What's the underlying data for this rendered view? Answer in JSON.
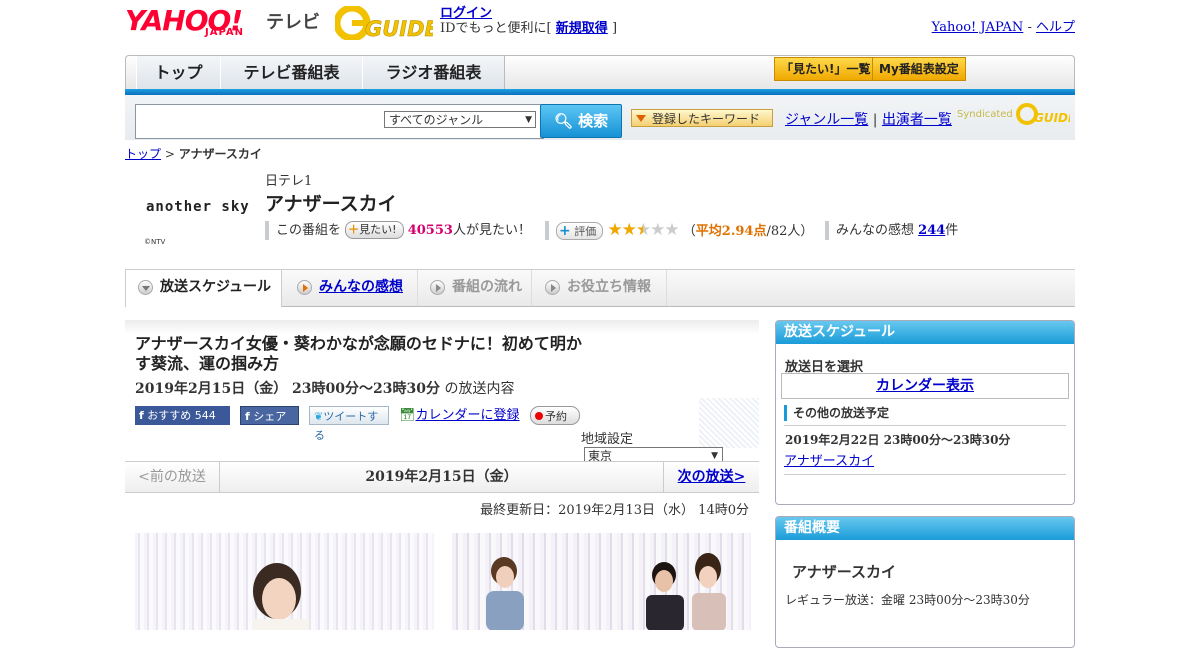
{
  "header": {
    "logo_yahoo": "YAHOO!",
    "logo_japan": "JAPAN",
    "logo_tv": "テレビ",
    "logo_guide": "GUIDE",
    "login_label": "ログイン",
    "id_text": "IDでもっと便利に[",
    "signup_label": "新規取得",
    "id_text_end": "]",
    "yahoo_japan_link": "Yahoo! JAPAN",
    "dash": "-",
    "help_link": "ヘルプ"
  },
  "gnav": {
    "tabs": [
      "トップ",
      "テレビ番組表",
      "ラジオ番組表"
    ],
    "mitai_list": "「見たい!」一覧",
    "my_bangumi": "My番組表設定"
  },
  "search": {
    "placeholder": "",
    "genre_selected": "すべてのジャンル",
    "search_button": "検索",
    "keyword_button": "登録したキーワード",
    "genre_list": "ジャンル一覧",
    "pipe": "|",
    "performer_list": "出演者一覧",
    "syndicated": "Syndicated"
  },
  "breadcrumb": {
    "top": "トップ",
    "separator": ">",
    "current": "アナザースカイ"
  },
  "program": {
    "logo_text": "another sky",
    "logo_credit": "©NTV",
    "channel": "日テレ1",
    "title": "アナザースカイ",
    "this_program": "この番組を",
    "mitai_button": "見たい!",
    "mitai_count": "40553",
    "mitai_suffix": "人が見たい！",
    "hyoka_button": "評価",
    "rating": 2.94,
    "avg_open": "（",
    "avg_label": "平均2.94点",
    "avg_count": "/82人）",
    "impressions_label": "みんなの感想",
    "impressions_count": "244",
    "impressions_suffix": "件"
  },
  "tabs": {
    "schedule": "放送スケジュール",
    "impressions": "みんなの感想",
    "flow": "番組の流れ",
    "info": "お役立ち情報"
  },
  "episode": {
    "title": "アナザースカイ女優・葵わかなが念願のセドナに！初めて明かす葵流、運の掴み方",
    "date": "2019年2月15日（金） 23時00分～23時30分",
    "date_suffix": "の放送内容",
    "fb_recommend": "おすすめ 544",
    "fb_share": "シェア",
    "tweet": "ツイートする",
    "calendar": "カレンダーに登録",
    "reserve": "予約",
    "region_label": "地域設定",
    "region_selected": "東京"
  },
  "pager": {
    "prev": "<前の放送",
    "current": "2019年2月15日（金）",
    "next": "次の放送>"
  },
  "updated": "最終更新日：2019年2月13日（水） 14時0分",
  "sidebar": {
    "schedule_title": "放送スケジュール",
    "select_date": "放送日を選択",
    "calendar_button": "カレンダー表示",
    "other_schedule": "その他の放送予定",
    "next_date": "2019年2月22日 23時00分～23時30分",
    "next_title": "アナザースカイ",
    "summary_title": "番組概要",
    "summary_name": "アナザースカイ",
    "regular": "レギュラー放送：金曜 23時00分～23時30分"
  },
  "colors": {
    "accent_blue": "#1a9bd8",
    "brand_red": "#ff0033",
    "star": "#f0a800",
    "pink": "#d6006c"
  }
}
